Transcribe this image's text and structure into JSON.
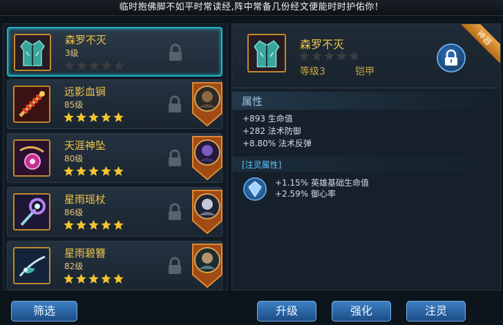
{
  "top_message": "临时抱佛脚不如平时常读经,阵中常备几份经文便能时时护佑你！",
  "items": [
    {
      "name": "森罗不灭",
      "level": "3级",
      "stars": 0,
      "selected": true,
      "hero": null,
      "icon": "armor-icon"
    },
    {
      "name": "远影血锏",
      "level": "85级",
      "stars": 5,
      "selected": false,
      "hero": "warrior",
      "icon": "mace-icon"
    },
    {
      "name": "天涯神坠",
      "level": "80级",
      "stars": 5,
      "selected": false,
      "hero": "mage",
      "icon": "pendant-icon"
    },
    {
      "name": "星雨瑶杖",
      "level": "86级",
      "stars": 5,
      "selected": false,
      "hero": "sorceress",
      "icon": "staff-icon"
    },
    {
      "name": "星雨碧簪",
      "level": "82级",
      "stars": 5,
      "selected": false,
      "hero": "knight",
      "icon": "hairpin-icon"
    }
  ],
  "detail": {
    "name": "森罗不灭",
    "stars": 0,
    "level": "等级3",
    "type": "铠甲",
    "ribbon": "神器",
    "attr_title": "属性",
    "attrs": [
      "+893 生命值",
      "+282 法术防御",
      "+8.80% 法术反弹"
    ],
    "infuse_title": "[注灵属性]",
    "infuse_attrs": [
      "+1.15% 英雄基础生命值",
      "+2.59% 御心率"
    ]
  },
  "buttons": {
    "filter": "筛选",
    "upgrade": "升级",
    "enhance": "强化",
    "infuse": "注灵"
  },
  "colors": {
    "accent": "#1fb3c7",
    "gold": "#f2c64a",
    "button": "#2a65a5"
  }
}
